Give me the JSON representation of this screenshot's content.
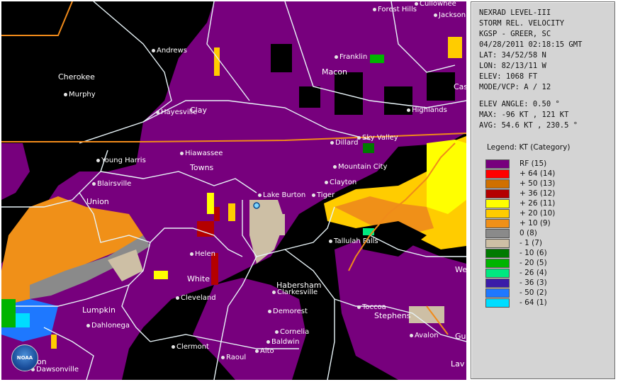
{
  "header": {
    "title": "NEXRAD LEVEL-III",
    "product": "STORM REL. VELOCITY",
    "station": "KGSP - GREER, SC",
    "datetime": "04/28/2011 02:18:15 GMT",
    "lat": "LAT: 34/52/58 N",
    "lon": "LON: 82/13/11 W",
    "elev": "ELEV: 1068 FT",
    "mode": "MODE/VCP: A / 12",
    "elev_angle": "ELEV ANGLE: 0.50 °",
    "max": "MAX: -96 KT , 121 KT",
    "avg": "AVG: 54.6 KT , 230.5 °"
  },
  "legend": {
    "title": "Legend: KT (Category)",
    "items": [
      {
        "label": "RF  (15)",
        "color": "#77007d"
      },
      {
        "label": "+ 64  (14)",
        "color": "#ff0000"
      },
      {
        "label": "+ 50  (13)",
        "color": "#d07000"
      },
      {
        "label": "+ 36  (12)",
        "color": "#b40000"
      },
      {
        "label": "+ 26  (11)",
        "color": "#ffff00"
      },
      {
        "label": "+ 20  (10)",
        "color": "#ffcc00"
      },
      {
        "label": "+ 10  (9)",
        "color": "#f09018"
      },
      {
        "label": "0  (8)",
        "color": "#8a8a8a"
      },
      {
        "label": "- 1  (7)",
        "color": "#cdbfa5"
      },
      {
        "label": "- 10  (6)",
        "color": "#007a00"
      },
      {
        "label": "- 20  (5)",
        "color": "#00b400"
      },
      {
        "label": "- 26  (4)",
        "color": "#00e880"
      },
      {
        "label": "- 36  (3)",
        "color": "#3a1ca8"
      },
      {
        "label": "- 50  (2)",
        "color": "#1e78ff"
      },
      {
        "label": "- 64  (1)",
        "color": "#00ddff"
      }
    ]
  },
  "map": {
    "places": [
      "Forest Hills",
      "Cullowhee",
      "Jackson",
      "Andrews",
      "Franklin",
      "Cherokee",
      "Macon",
      "Murphy",
      "Clay",
      "Hayesville",
      "Highlands",
      "Cas",
      "Dillard",
      "Sky Valley",
      "Hiawassee",
      "Young Harris",
      "Towns",
      "Mountain City",
      "Blairsville",
      "Clayton",
      "Lake Burton",
      "Tiger",
      "Union",
      "Tallulah Falls",
      "Helen",
      "White",
      "Habersham",
      "Clarkesville",
      "We",
      "Cleveland",
      "Toccoa",
      "Lumpkin",
      "Stephens",
      "Demorest",
      "Dahlonega",
      "Cornelia",
      "Baldwin",
      "Avalon",
      "Gu",
      "Clermont",
      "Alto",
      "Raoul",
      "Dawson",
      "Dawsonville",
      "Lav"
    ],
    "logo": "NOAA"
  }
}
